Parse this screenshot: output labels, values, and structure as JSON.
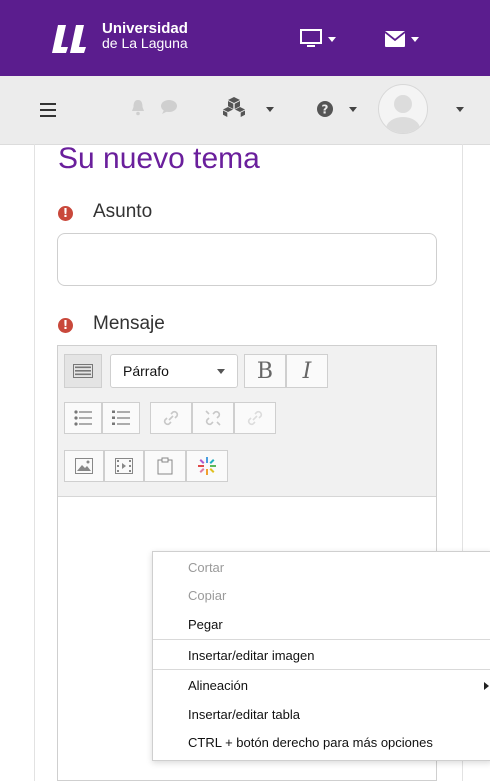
{
  "header": {
    "logo_line1": "Universidad",
    "logo_line2": "de La Laguna",
    "brand_color": "#5b1d8e",
    "icons": [
      "monitor-icon",
      "envelope-icon"
    ]
  },
  "navbar": {
    "icons": [
      "menu-icon",
      "bell-icon",
      "chat-icon",
      "cubes-icon",
      "help-icon",
      "user-avatar"
    ]
  },
  "page": {
    "title": "Su nuevo tema",
    "title_color": "#6a1f9c"
  },
  "form": {
    "subject_label": "Asunto",
    "subject_value": "",
    "message_label": "Mensaje",
    "required_color": "#c9483b"
  },
  "editor": {
    "format_value": "Párrafo",
    "bold_label": "B",
    "italic_label": "I"
  },
  "context_menu": {
    "items": [
      {
        "label": "Cortar",
        "disabled": true
      },
      {
        "label": "Copiar",
        "disabled": true
      },
      {
        "label": "Pegar",
        "disabled": false
      },
      {
        "label": "Insertar/editar imagen",
        "disabled": false
      },
      {
        "label": "Alineación",
        "disabled": false,
        "submenu": true
      },
      {
        "label": "Insertar/editar tabla",
        "disabled": false
      },
      {
        "label": "CTRL + botón derecho para más opciones",
        "disabled": false
      }
    ]
  }
}
